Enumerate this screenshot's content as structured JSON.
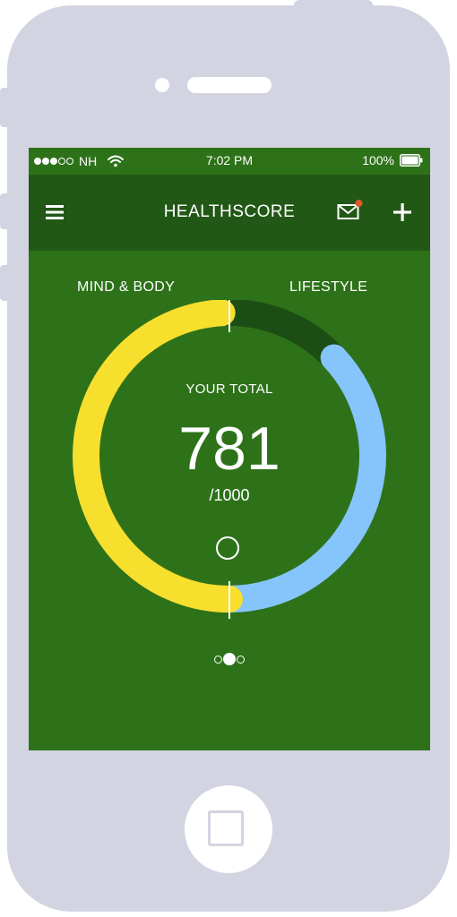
{
  "status_bar": {
    "carrier": "NH",
    "signal_bars_filled": 3,
    "signal_bars_total": 5,
    "time": "7:02 PM",
    "battery": "100%",
    "battery_level": 1.0
  },
  "nav": {
    "title": "HEALTHSCORE",
    "menu_icon": "hamburger-menu-icon",
    "mail_icon": "mail-icon",
    "mail_has_notification": true,
    "add_icon": "plus-icon"
  },
  "tabs": {
    "left": "MIND & BODY",
    "right": "LIFESTYLE"
  },
  "score": {
    "label": "YOUR TOTAL",
    "value": "781",
    "max": "/1000",
    "mind_body_fraction": 0.5,
    "lifestyle_fraction": 0.37
  },
  "pager": {
    "count": 3,
    "active_index": 1
  },
  "colors": {
    "screen_bg": "#2d7219",
    "nav_bg": "#225816",
    "track": "#1c4d14",
    "mind_body": "#f7df2e",
    "lifestyle": "#86c5fb",
    "notification_dot": "#e0582b",
    "phone_body": "#d3d4e1"
  }
}
